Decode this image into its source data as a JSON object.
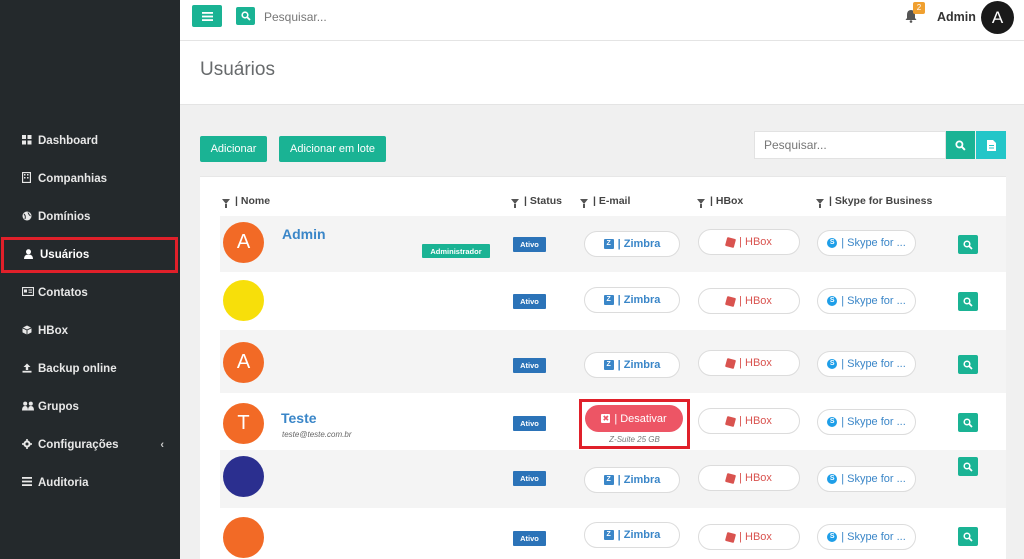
{
  "colors": {
    "sidebar_bg": "#24292c",
    "accent": "#1ab394",
    "status_blue": "#2b73b8",
    "danger": "#ed5565",
    "highlight": "#e0202a"
  },
  "topbar": {
    "search_placeholder": "Pesquisar...",
    "notification_count": "2",
    "user_name": "Admin",
    "avatar_initial": "A"
  },
  "sidebar": {
    "items": [
      {
        "label": "Dashboard",
        "icon": "grid-icon"
      },
      {
        "label": "Companhias",
        "icon": "building-icon"
      },
      {
        "label": "Domínios",
        "icon": "globe-icon"
      },
      {
        "label": "Usuários",
        "icon": "user-icon",
        "active": true
      },
      {
        "label": "Contatos",
        "icon": "id-card-icon"
      },
      {
        "label": "HBox",
        "icon": "cube-icon"
      },
      {
        "label": "Backup online",
        "icon": "upload-icon"
      },
      {
        "label": "Grupos",
        "icon": "users-icon"
      },
      {
        "label": "Configurações",
        "icon": "gear-icon",
        "has_submenu": true
      },
      {
        "label": "Auditoria",
        "icon": "list-icon"
      }
    ]
  },
  "page": {
    "title": "Usuários",
    "add_label": "Adicionar",
    "add_batch_label": "Adicionar em lote",
    "search_placeholder": "Pesquisar..."
  },
  "table": {
    "columns": [
      "| Nome",
      "| Status",
      "| E-mail",
      "| HBox",
      "| Skype for Business"
    ],
    "pill_labels": {
      "zimbra": "| Zimbra",
      "hbox": "| HBox",
      "skype": "| Skype for ...",
      "deactivate": "| Desativar"
    },
    "rows": [
      {
        "initial": "A",
        "avatar_color": "#f26a26",
        "name": "Admin",
        "email": "",
        "role": "Administrador",
        "status": "Ativo",
        "email_state": "zimbra"
      },
      {
        "initial": "",
        "avatar_color": "#f7df0a",
        "name": "",
        "email": "",
        "role": "",
        "status": "Ativo",
        "email_state": "zimbra"
      },
      {
        "initial": "A",
        "avatar_color": "#f26a26",
        "name": "",
        "email": "",
        "role": "",
        "status": "Ativo",
        "email_state": "zimbra"
      },
      {
        "initial": "T",
        "avatar_color": "#f26a26",
        "name": "Teste",
        "email": "teste@teste.com.br",
        "role": "",
        "status": "Ativo",
        "email_state": "deactivate",
        "email_note": "Z-Suite 25 GB"
      },
      {
        "initial": "",
        "avatar_color": "#2b2f8f",
        "name": "",
        "email": "",
        "role": "",
        "status": "Ativo",
        "email_state": "zimbra"
      },
      {
        "initial": "",
        "avatar_color": "#f26a26",
        "name": "",
        "email": "",
        "role": "",
        "status": "Ativo",
        "email_state": "zimbra"
      }
    ]
  }
}
